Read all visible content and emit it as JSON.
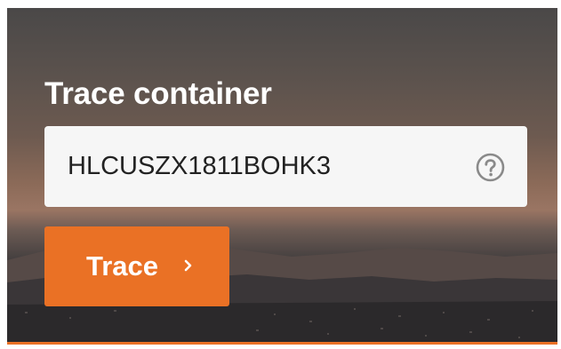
{
  "widget": {
    "title": "Trace container",
    "input_value": "HLCUSZX1811BOHK3",
    "input_placeholder": "",
    "help_icon": "question-circle-icon",
    "button_label": "Trace",
    "button_icon": "chevron-right-icon"
  },
  "colors": {
    "accent": "#ea7125",
    "input_background": "#f6f6f6",
    "title_text": "#ffffff",
    "input_text": "#222222",
    "help_icon": "#8a8a8a"
  }
}
